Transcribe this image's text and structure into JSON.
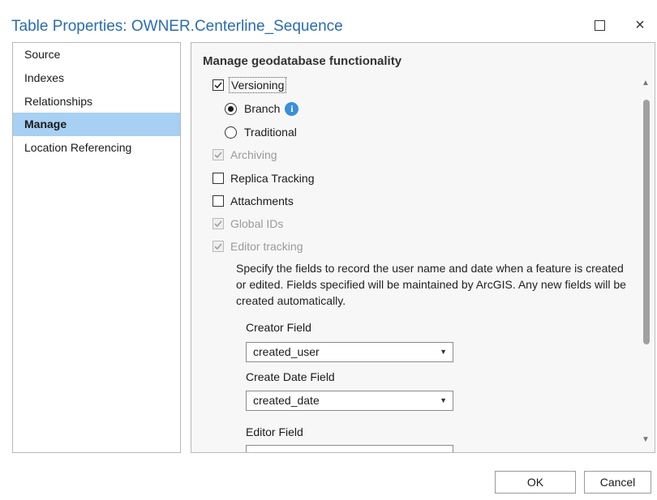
{
  "window": {
    "title": "Table Properties: OWNER.Centerline_Sequence",
    "maximize_icon": "maximize-icon",
    "close_glyph": "×"
  },
  "sidebar": {
    "items": [
      {
        "label": "Source",
        "active": false
      },
      {
        "label": "Indexes",
        "active": false
      },
      {
        "label": "Relationships",
        "active": false
      },
      {
        "label": "Manage",
        "active": true
      },
      {
        "label": "Location Referencing",
        "active": false
      }
    ]
  },
  "manage": {
    "section_title": "Manage geodatabase functionality",
    "versioning": {
      "label": "Versioning",
      "checked": true
    },
    "branch": {
      "label": "Branch",
      "selected": true,
      "info_glyph": "i"
    },
    "traditional": {
      "label": "Traditional",
      "selected": false
    },
    "archiving": {
      "label": "Archiving",
      "checked": true,
      "disabled": true
    },
    "replica_tracking": {
      "label": "Replica Tracking",
      "checked": false
    },
    "attachments": {
      "label": "Attachments",
      "checked": false
    },
    "global_ids": {
      "label": "Global IDs",
      "checked": true,
      "disabled": true
    },
    "editor_tracking": {
      "label": "Editor tracking",
      "checked": true,
      "disabled": true
    },
    "editor_tracking_description": "Specify the fields to record the user name and date when a feature is created or edited. Fields specified will be maintained by ArcGIS. Any new fields will be created automatically.",
    "creator_field": {
      "label": "Creator Field",
      "value": "created_user"
    },
    "create_date_field": {
      "label": "Create Date Field",
      "value": "created_date"
    },
    "editor_field": {
      "label": "Editor Field",
      "value": ""
    }
  },
  "footer": {
    "ok_label": "OK",
    "cancel_label": "Cancel"
  },
  "colors": {
    "title": "#2a6cb0",
    "active_item_bg": "#a7d0f2",
    "info_icon": "#3a8fd9"
  }
}
